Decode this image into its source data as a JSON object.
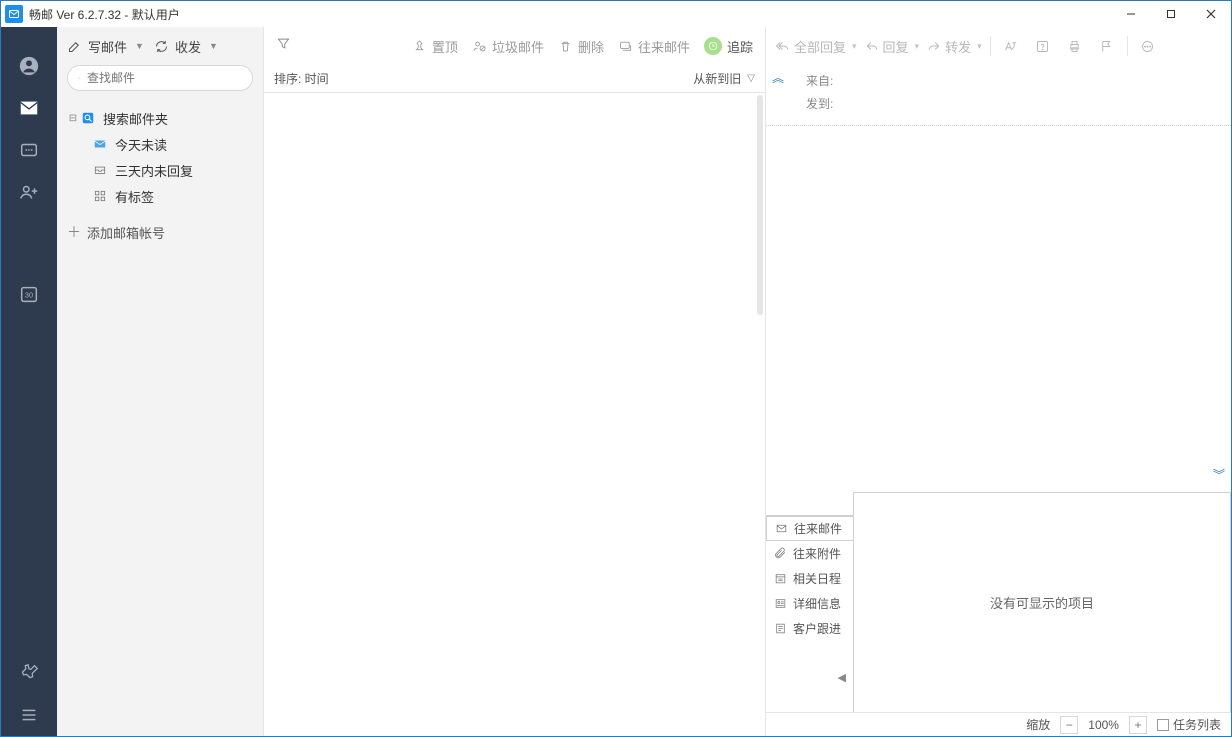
{
  "title": "畅邮 Ver 6.2.7.32  -  默认用户",
  "folder_toolbar": {
    "compose": "写邮件",
    "sendrecv": "收发"
  },
  "search": {
    "placeholder": "查找邮件"
  },
  "folders": {
    "root": "搜索邮件夹",
    "today_unread": "今天未读",
    "three_day_noreply": "三天内未回复",
    "tagged": "有标签",
    "add_account": "添加邮箱帐号"
  },
  "list_toolbar": {
    "pin": "置顶",
    "junk": "垃圾邮件",
    "delete": "删除",
    "correspond": "往来邮件",
    "track": "追踪"
  },
  "sort": {
    "label": "排序: 时间",
    "order": "从新到旧"
  },
  "read_toolbar": {
    "reply_all": "全部回复",
    "reply": "回复",
    "forward": "转发"
  },
  "read_header": {
    "from": "来自:",
    "to": "发到:"
  },
  "side_tabs": {
    "mails": "往来邮件",
    "attachments": "往来附件",
    "schedule": "相关日程",
    "details": "详细信息",
    "followup": "客户跟进"
  },
  "bottom_empty": "没有可显示的项目",
  "status": {
    "zoom_label": "缩放",
    "zoom_value": "100%",
    "task_list": "任务列表"
  }
}
